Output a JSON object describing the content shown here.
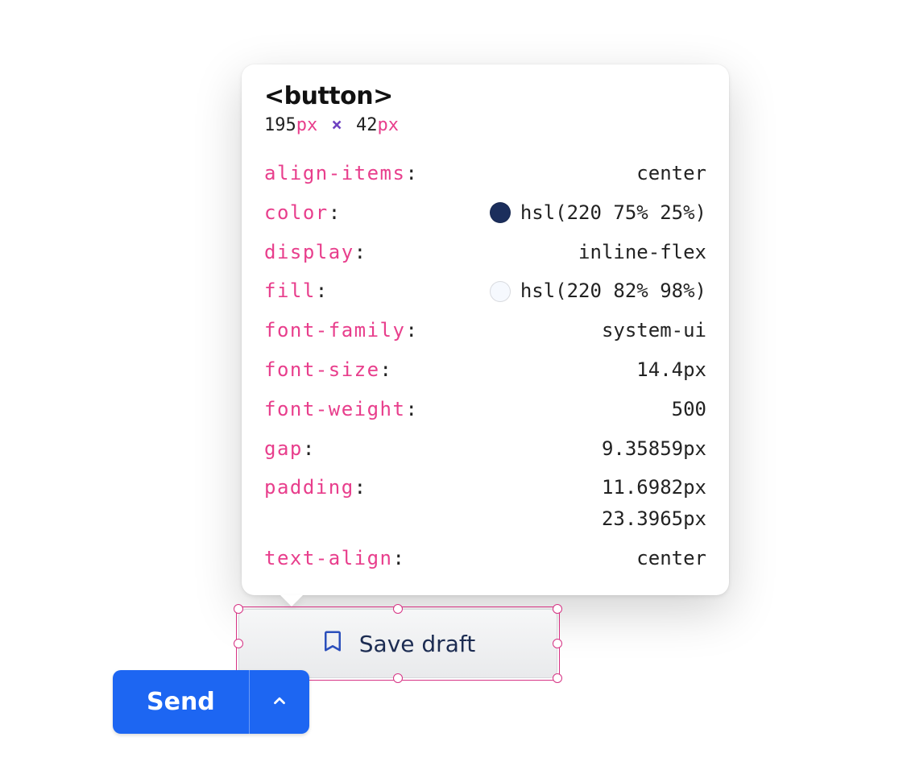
{
  "inspector": {
    "tag": "<button>",
    "dimensions": {
      "width": "195",
      "height": "42",
      "unit": "px"
    },
    "props": [
      {
        "key": "align-items",
        "value": "center"
      },
      {
        "key": "color",
        "value": "hsl(220 75% 25%)",
        "swatch": "#1b2e5c"
      },
      {
        "key": "display",
        "value": "inline-flex"
      },
      {
        "key": "fill",
        "value": "hsl(220 82% 98%)",
        "swatch": "#f6f9fe"
      },
      {
        "key": "font-family",
        "value": "system-ui"
      },
      {
        "key": "font-size",
        "value": "14.4px"
      },
      {
        "key": "font-weight",
        "value": "500"
      },
      {
        "key": "gap",
        "value": "9.35859px"
      },
      {
        "key": "padding",
        "value": [
          "11.6982px",
          "23.3965px"
        ]
      },
      {
        "key": "text-align",
        "value": "center"
      }
    ]
  },
  "target_button": {
    "icon": "bookmark-icon",
    "label": "Save draft"
  },
  "send_button": {
    "label": "Send",
    "caret_icon": "chevron-up-icon"
  }
}
